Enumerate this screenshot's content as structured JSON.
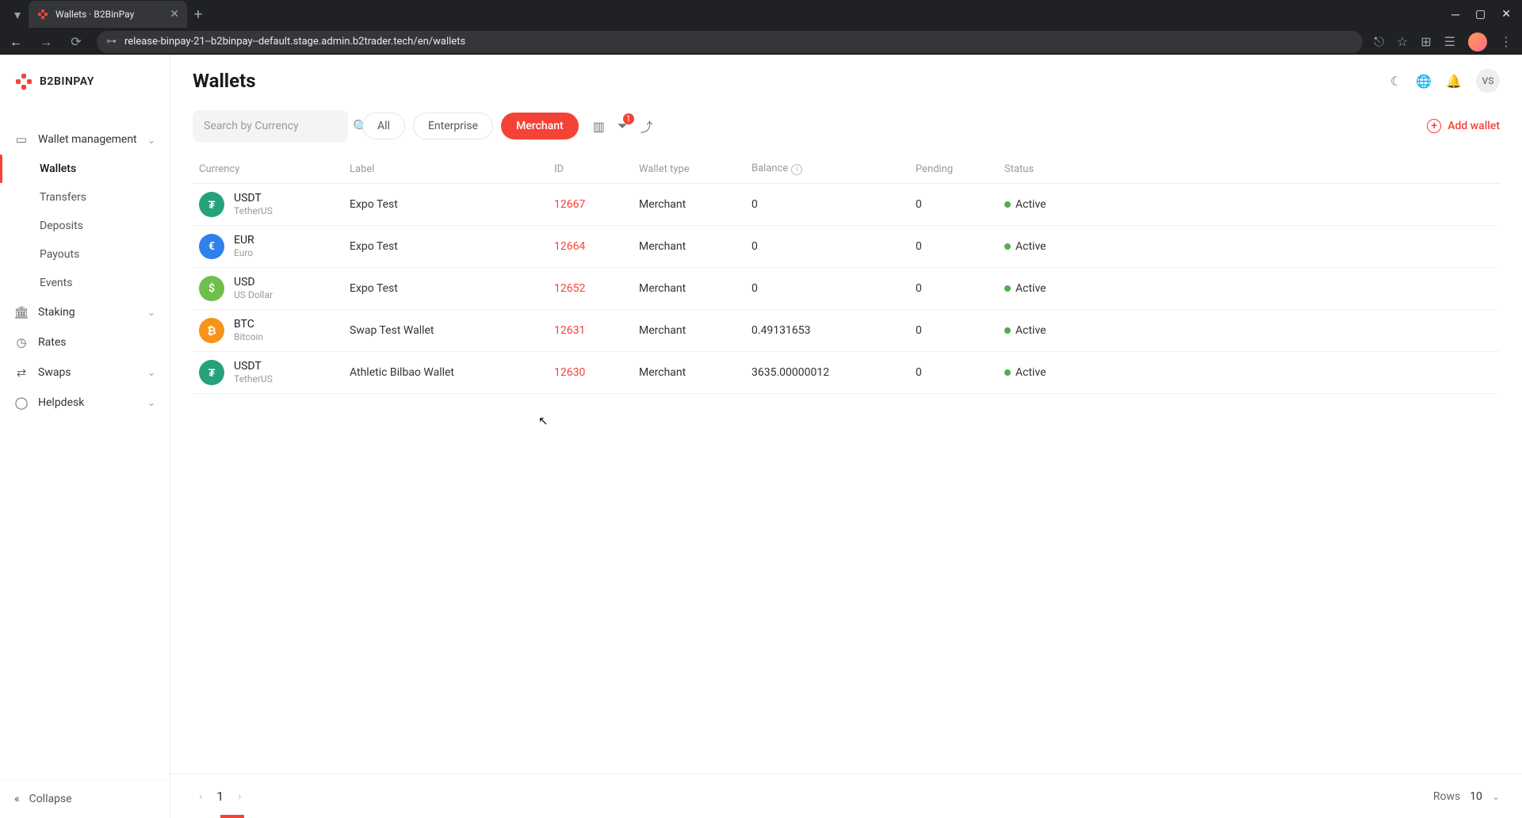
{
  "browser": {
    "tab_title": "Wallets · B2BinPay",
    "url": "release-binpay-21--b2binpay--default.stage.admin.b2trader.tech/en/wallets"
  },
  "brand": "B2BINPAY",
  "page_title": "Wallets",
  "user_initials": "VS",
  "search": {
    "placeholder": "Search by Currency"
  },
  "filters": {
    "all": "All",
    "enterprise": "Enterprise",
    "merchant": "Merchant"
  },
  "filter_badge": "1",
  "add_wallet_label": "Add wallet",
  "sidebar": {
    "groups": [
      {
        "label": "Wallet management",
        "icon": "wallet",
        "expanded": true,
        "items": [
          {
            "label": "Wallets",
            "active": true
          },
          {
            "label": "Transfers"
          },
          {
            "label": "Deposits"
          },
          {
            "label": "Payouts"
          },
          {
            "label": "Events"
          }
        ]
      },
      {
        "label": "Staking",
        "icon": "bank",
        "expanded": false
      },
      {
        "label": "Rates",
        "icon": "clock",
        "expanded": false,
        "has_chev": false
      },
      {
        "label": "Swaps",
        "icon": "swap",
        "expanded": false
      },
      {
        "label": "Helpdesk",
        "icon": "help",
        "expanded": false
      }
    ],
    "collapse_label": "Collapse"
  },
  "table": {
    "headers": {
      "currency": "Currency",
      "label": "Label",
      "id": "ID",
      "wallet_type": "Wallet type",
      "balance": "Balance",
      "pending": "Pending",
      "status": "Status"
    },
    "rows": [
      {
        "code": "USDT",
        "name": "TetherUS",
        "color": "#26a17b",
        "sym": "₮",
        "label": "Expo Test",
        "id": "12667",
        "type": "Merchant",
        "balance": "0",
        "pending": "0",
        "status": "Active"
      },
      {
        "code": "EUR",
        "name": "Euro",
        "color": "#2f80ed",
        "sym": "€",
        "label": "Expo Test",
        "id": "12664",
        "type": "Merchant",
        "balance": "0",
        "pending": "0",
        "status": "Active"
      },
      {
        "code": "USD",
        "name": "US Dollar",
        "color": "#6fbf4b",
        "sym": "$",
        "label": "Expo Test",
        "id": "12652",
        "type": "Merchant",
        "balance": "0",
        "pending": "0",
        "status": "Active"
      },
      {
        "code": "BTC",
        "name": "Bitcoin",
        "color": "#f7931a",
        "sym": "₿",
        "label": "Swap Test Wallet",
        "id": "12631",
        "type": "Merchant",
        "balance": "0.49131653",
        "pending": "0",
        "status": "Active"
      },
      {
        "code": "USDT",
        "name": "TetherUS",
        "color": "#26a17b",
        "sym": "₮",
        "label": "Athletic Bilbao Wallet",
        "id": "12630",
        "type": "Merchant",
        "balance": "3635.00000012",
        "pending": "0",
        "status": "Active"
      }
    ]
  },
  "pagination": {
    "page": "1",
    "rows_label": "Rows",
    "rows_value": "10"
  }
}
